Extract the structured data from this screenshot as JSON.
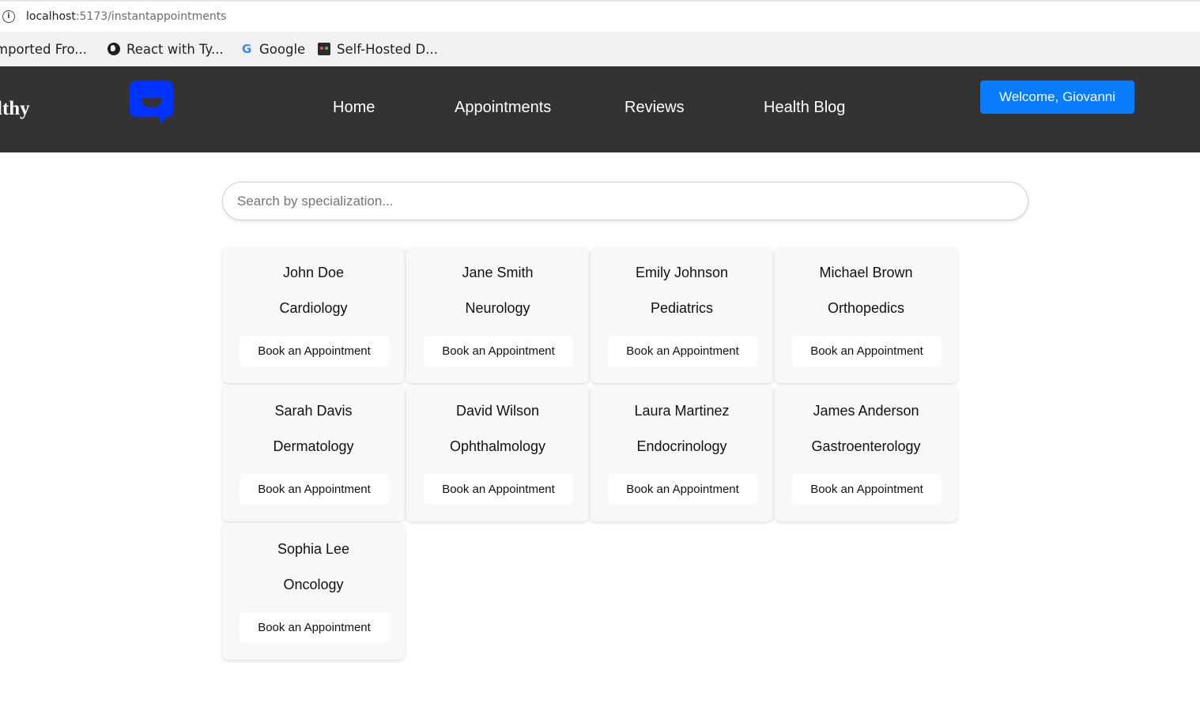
{
  "browser": {
    "url_host": "localhost",
    "url_path": ":5173/instantappointments",
    "bookmarks": [
      "mported Fro...",
      "React with Ty...",
      "Google",
      "Self-Hosted D..."
    ]
  },
  "navbar": {
    "brand": "lthy",
    "links": [
      "Home",
      "Appointments",
      "Reviews",
      "Health Blog"
    ],
    "welcome": "Welcome, Giovanni",
    "accent_color": "#0a7cff",
    "background_color": "#333333"
  },
  "search": {
    "placeholder": "Search by specialization...",
    "value": ""
  },
  "doctors": [
    {
      "name": "John Doe",
      "specialization": "Cardiology",
      "button": "Book an Appointment"
    },
    {
      "name": "Jane Smith",
      "specialization": "Neurology",
      "button": "Book an Appointment"
    },
    {
      "name": "Emily Johnson",
      "specialization": "Pediatrics",
      "button": "Book an Appointment"
    },
    {
      "name": "Michael Brown",
      "specialization": "Orthopedics",
      "button": "Book an Appointment"
    },
    {
      "name": "Sarah Davis",
      "specialization": "Dermatology",
      "button": "Book an Appointment"
    },
    {
      "name": "David Wilson",
      "specialization": "Ophthalmology",
      "button": "Book an Appointment"
    },
    {
      "name": "Laura Martinez",
      "specialization": "Endocrinology",
      "button": "Book an Appointment"
    },
    {
      "name": "James Anderson",
      "specialization": "Gastroenterology",
      "button": "Book an Appointment"
    },
    {
      "name": "Sophia Lee",
      "specialization": "Oncology",
      "button": "Book an Appointment"
    }
  ]
}
